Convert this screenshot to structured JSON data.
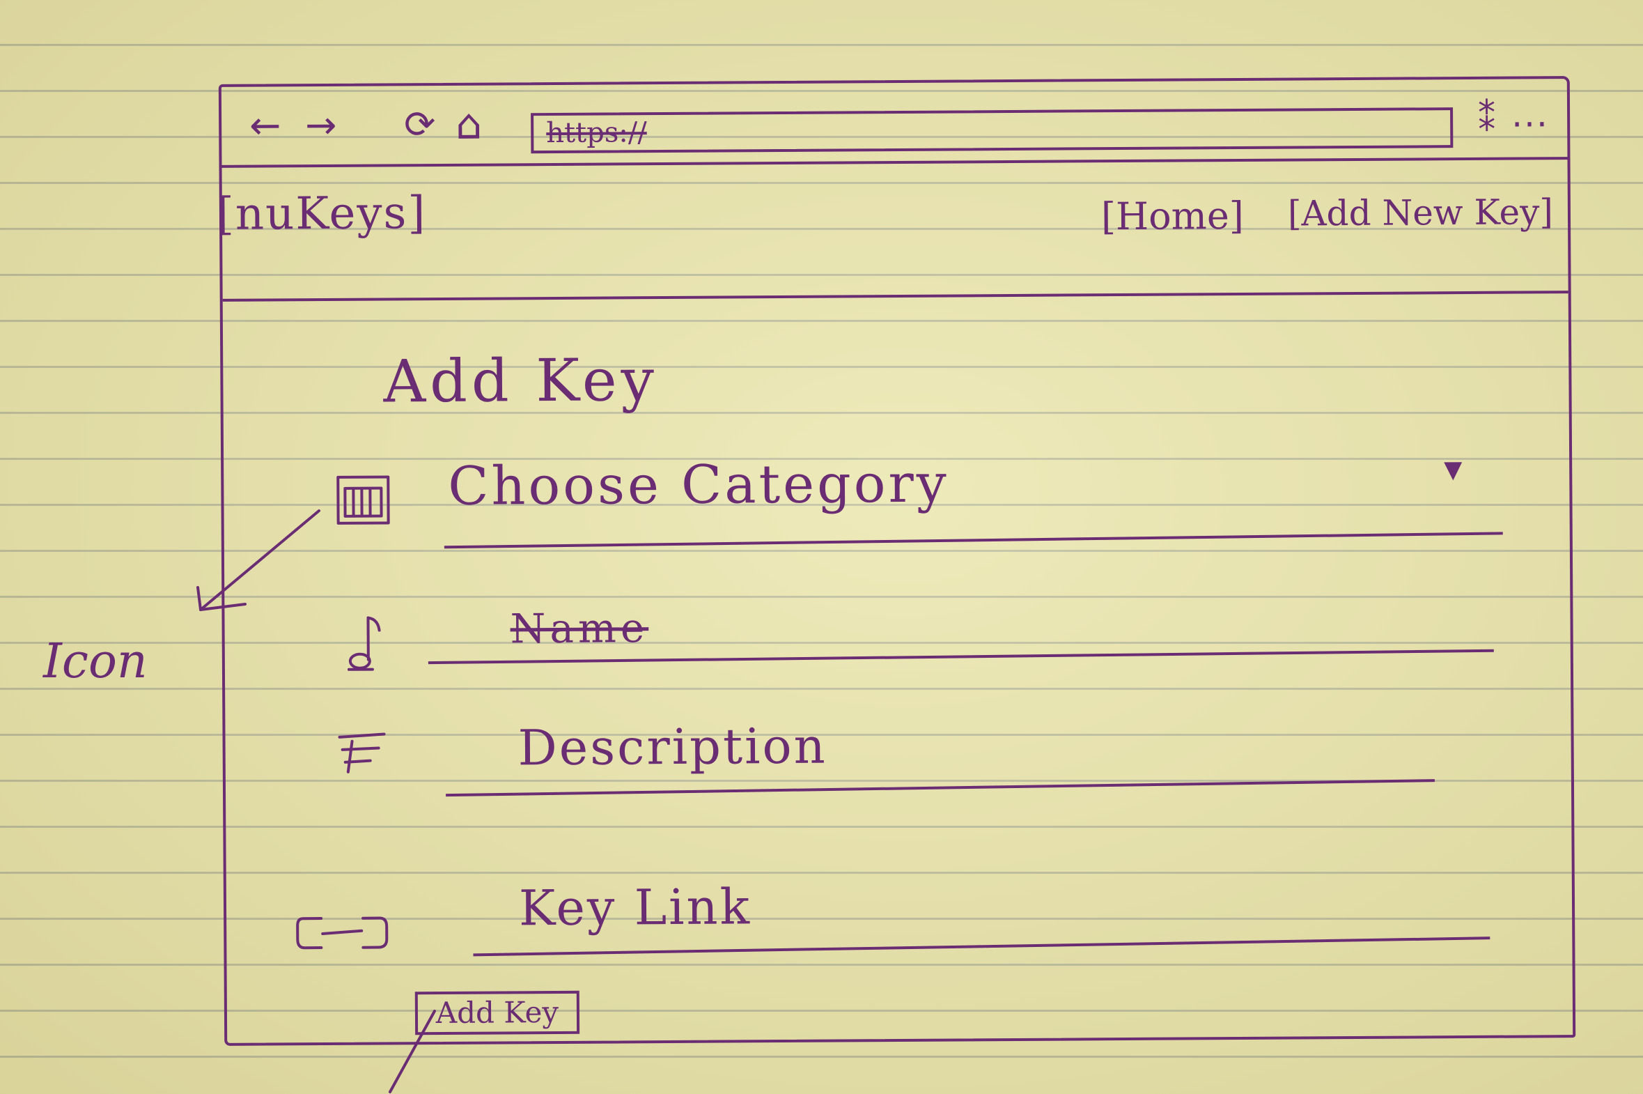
{
  "browser": {
    "back_icon": "←",
    "forward_icon": "→",
    "reload_icon": "⟳",
    "home_icon": "⌂",
    "url": "https://",
    "extension_icon": "⁑",
    "more_icon": "..."
  },
  "site": {
    "logo": "[nuKeys]",
    "nav": [
      {
        "label": "[Home]"
      },
      {
        "label": "[Add New Key]"
      }
    ]
  },
  "form": {
    "title": "Add Key",
    "category": {
      "label": "Choose Category",
      "arrow": "▼"
    },
    "name": {
      "label": "Name"
    },
    "description": {
      "label": "Description"
    },
    "key_link": {
      "label": "Key Link"
    },
    "submit_label": "Add Key"
  },
  "annotation": {
    "text": "Icon"
  }
}
